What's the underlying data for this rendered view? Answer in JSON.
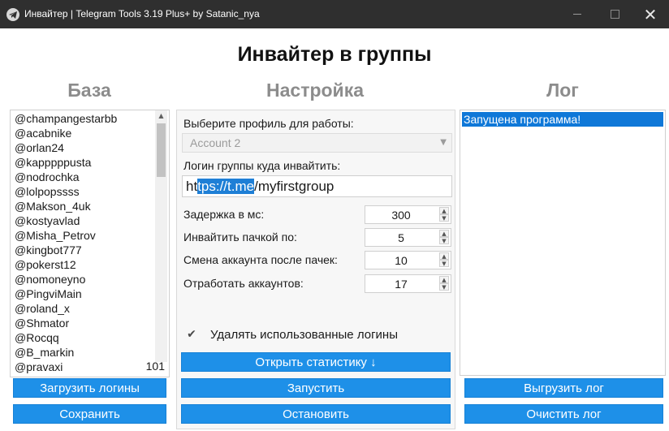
{
  "window": {
    "title": "Инвайтер | Telegram Tools 3.19 Plus+ by Satanic_nya",
    "close_glyph": "✕"
  },
  "page_title": "Инвайтер в группы",
  "sections": {
    "base": "База",
    "settings": "Настройка",
    "log": "Лог"
  },
  "base": {
    "logins": [
      "@champangestarbb",
      "@acabnike",
      "@orlan24",
      "@kapppppusta",
      "@nodrochka",
      "@lolpopssss",
      "@Makson_4uk",
      "@kostyavlad",
      "@Misha_Petrov",
      "@kingbot777",
      "@pokerst12",
      "@nomoneyno",
      "@PingviMain",
      "@roland_x",
      "@Shmator",
      "@Rocqq",
      "@B_markin",
      "@pravaxi"
    ],
    "count": "101",
    "load_button": "Загрузить логины",
    "save_button": "Сохранить"
  },
  "settings": {
    "profile_label": "Выберите профиль для работы:",
    "profile_value": "Account 2",
    "group_label": "Логин группы куда инвайтить:",
    "group_value_before": "ht",
    "group_value_selected": "tps://t.me",
    "group_value_after": "/myfirstgroup",
    "delay_label": "Задержка в мс:",
    "delay_value": "300",
    "batch_label": "Инвайтить пачкой по:",
    "batch_value": "5",
    "switch_label": "Смена аккаунта после пачек:",
    "switch_value": "10",
    "accounts_label": "Отработать аккаунтов:",
    "accounts_value": "17",
    "remove_used_label": "Удалять использованные логины",
    "remove_used_checked": true,
    "stats_button": "Открыть статистику ↓",
    "start_button": "Запустить",
    "stop_button": "Остановить"
  },
  "log": {
    "entries": [
      "Запущена программа!"
    ],
    "export_button": "Выгрузить лог",
    "clear_button": "Очистить лог"
  }
}
